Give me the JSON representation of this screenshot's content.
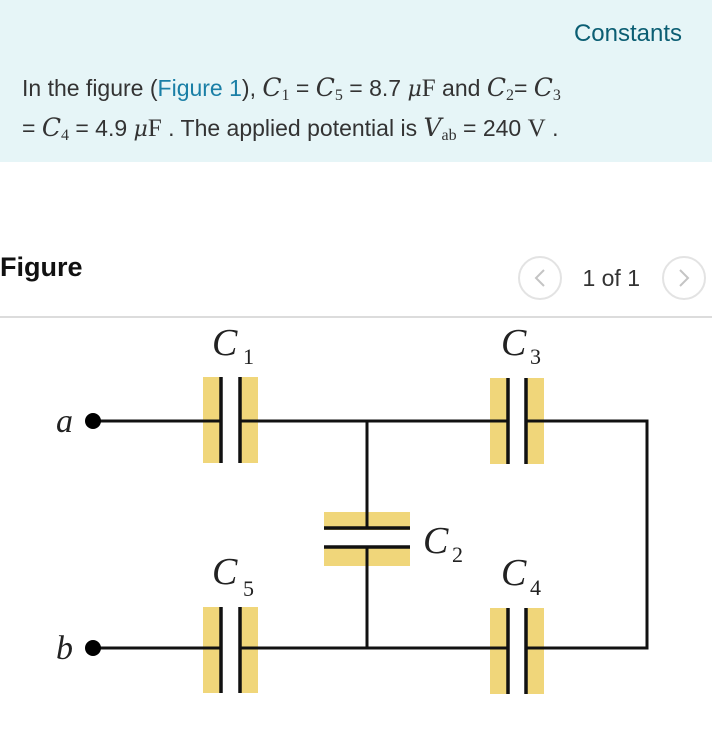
{
  "header": {
    "constants_link": "Constants"
  },
  "problem": {
    "intro": "In the figure (",
    "figure_link": "Figure 1",
    "after_link": "), ",
    "c1_var": "C",
    "c1_sub": "1",
    "eq1": " = ",
    "c5_var": "C",
    "c5_sub": "5",
    "eq2": " = 8.7 ",
    "unit_mu": "μ",
    "unit_F": "F",
    "and": " and ",
    "c2_var": "C",
    "c2_sub": "2",
    "eq3": "= ",
    "c3_var": "C",
    "c3_sub": "3",
    "eq4": "= ",
    "c4_var": "C",
    "c4_sub": "4",
    "eq5": " = 4.9 ",
    "unit2_mu": "μ",
    "unit2_F": "F",
    "sentence2": " . The applied potential is ",
    "v_var": "V",
    "v_sub": "ab",
    "eq6": " = 240 ",
    "v_unit": "V",
    "end": " ."
  },
  "figure": {
    "title": "Figure",
    "pager": {
      "prev_icon": "chevron-left-icon",
      "text": "1 of 1",
      "next_icon": "chevron-right-icon"
    },
    "circuit": {
      "terminal_a": "a",
      "terminal_b": "b",
      "capacitors": [
        {
          "name": "C",
          "sub": "1"
        },
        {
          "name": "C",
          "sub": "2"
        },
        {
          "name": "C",
          "sub": "3"
        },
        {
          "name": "C",
          "sub": "4"
        },
        {
          "name": "C",
          "sub": "5"
        }
      ],
      "plate_highlight_color": "#f0d67a",
      "wire_color": "#111111"
    }
  }
}
